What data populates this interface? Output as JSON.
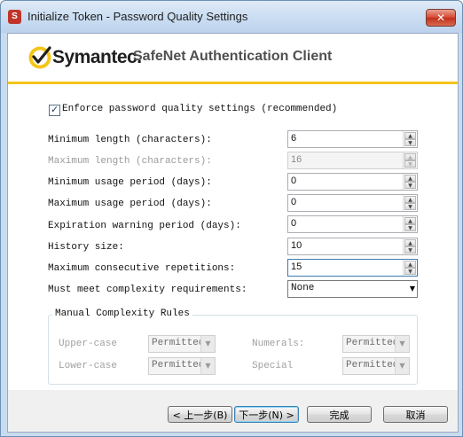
{
  "window": {
    "title": "Initialize Token - Password Quality Settings",
    "app_icon_letter": "S",
    "close_glyph": "✕"
  },
  "banner": {
    "brand": "Symantec.",
    "product": "SafeNet Authentication Client",
    "accent_color": "#f5c518"
  },
  "enforce": {
    "label": "Enforce password quality settings (recommended)",
    "checked": true,
    "check_glyph": "✓"
  },
  "fields": {
    "min_length": {
      "label": "Minimum length (characters):",
      "value": "6"
    },
    "max_length": {
      "label": "Maximum length (characters):",
      "value": "16",
      "disabled": true
    },
    "min_usage": {
      "label": "Minimum usage period (days):",
      "value": "0"
    },
    "max_usage": {
      "label": "Maximum usage period (days):",
      "value": "0"
    },
    "expiration_warning": {
      "label": "Expiration warning period (days):",
      "value": "0"
    },
    "history_size": {
      "label": "History size:",
      "value": "10"
    },
    "max_repetitions": {
      "label": "Maximum consecutive repetitions:",
      "value": "15"
    },
    "complexity": {
      "label": "Must meet complexity requirements:",
      "value": "None"
    }
  },
  "manual_rules": {
    "title": "Manual Complexity Rules",
    "upper_case": {
      "label": "Upper-case",
      "value": "Permitted"
    },
    "lower_case": {
      "label": "Lower-case",
      "value": "Permitted"
    },
    "numerals": {
      "label": "Numerals:",
      "value": "Permitted"
    },
    "special": {
      "label": "Special",
      "value": "Permitted"
    }
  },
  "buttons": {
    "back": "< 上一步(B)",
    "next": "下一步(N) >",
    "finish": "完成",
    "cancel": "取消"
  },
  "icons": {
    "up": "▲",
    "down": "▼"
  }
}
